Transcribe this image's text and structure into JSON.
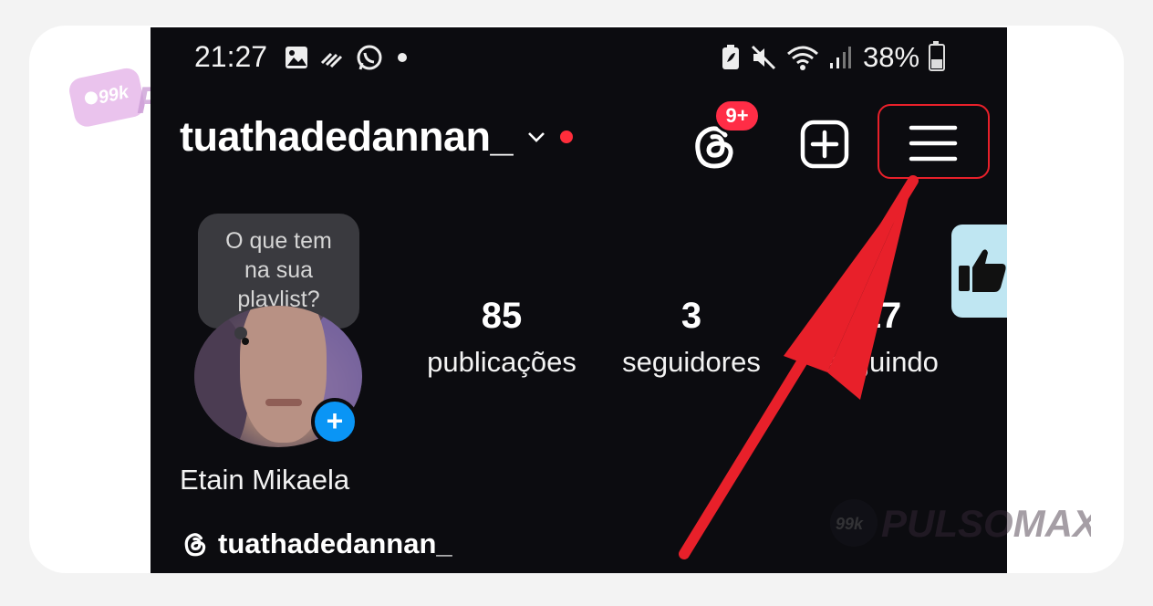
{
  "status_bar": {
    "time": "21:27",
    "battery_percent": "38%",
    "battery_level": 0.38,
    "icons_left": [
      "gallery-icon",
      "stylus-icon",
      "whatsapp-icon",
      "dot-icon"
    ],
    "icons_right": [
      "battery-saver-icon",
      "mute-icon",
      "wifi-icon",
      "signal-icon"
    ]
  },
  "header": {
    "username": "tuathadedannan_",
    "notification_badge": "9+",
    "accent_red": "#ff2d3b",
    "icons": [
      "chevron-down-icon",
      "threads-icon",
      "add-post-icon",
      "menu-icon"
    ]
  },
  "profile": {
    "tooltip_lines": [
      "O que tem",
      "na sua",
      "playlist?"
    ],
    "avatar_add_label": "+",
    "stats": {
      "posts_count": "85",
      "posts_label": "publicações",
      "followers_count": "3",
      "followers_label": "seguidores",
      "following_count": "17",
      "following_label": "seguindo"
    },
    "display_name": "Etain Mikaela",
    "threads_handle": "tuathadedannan_"
  },
  "watermarks": {
    "badge": "99k",
    "brand": "PULSOMAX"
  },
  "annotation": {
    "color": "#e8202a"
  }
}
